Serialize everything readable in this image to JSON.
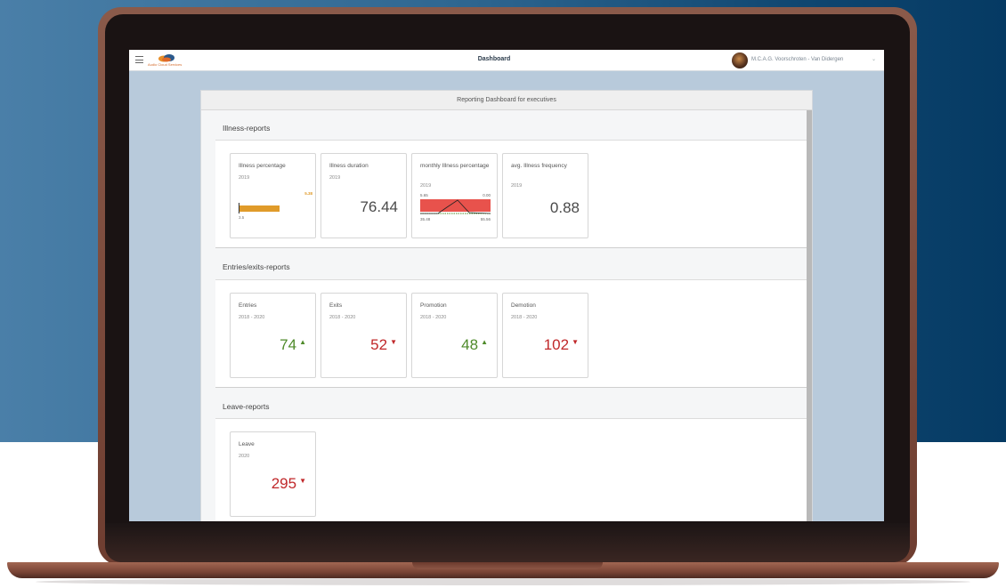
{
  "topbar": {
    "logo_text": "Audio Cloud Services",
    "title": "Dashboard",
    "user_name": "M.C.A.G. Voorschroten - Van Didergen",
    "user_chevron": "⌄"
  },
  "panel": {
    "header": "Reporting Dashboard for executives"
  },
  "sections": {
    "illness": {
      "title": "Illness-reports",
      "tiles": {
        "percentage": {
          "title": "Illness percentage",
          "year": "2019",
          "value_label": "5.38",
          "min_label": "3.5",
          "fill_fraction": 0.6
        },
        "duration": {
          "title": "Illness duration",
          "year": "2019",
          "value": "76.44"
        },
        "monthly": {
          "title": "monthly Illness percentage",
          "year": "2019",
          "y_top": "5.65",
          "y_right": "0.00",
          "x_left": "35.48",
          "x_right": "55.56"
        },
        "frequency": {
          "title": "avg. Illness frequency",
          "year": "2019",
          "value": "0.88"
        }
      }
    },
    "entries": {
      "title": "Entries/exits-reports",
      "tiles": {
        "entries": {
          "title": "Entries",
          "period": "2018 - 2020",
          "value": "74",
          "arrow": "▲"
        },
        "exits": {
          "title": "Exits",
          "period": "2018 - 2020",
          "value": "52",
          "arrow": "▼"
        },
        "promotion": {
          "title": "Promotion",
          "period": "2018 - 2020",
          "value": "48",
          "arrow": "▲"
        },
        "demotion": {
          "title": "Demotion",
          "period": "2018 - 2020",
          "value": "102",
          "arrow": "▼"
        }
      }
    },
    "leave": {
      "title": "Leave-reports",
      "tiles": {
        "leave": {
          "title": "Leave",
          "period": "2020",
          "value": "295",
          "arrow": "▼"
        }
      }
    }
  },
  "colors": {
    "good": "#4e8a2a",
    "bad": "#c0282a",
    "bar": "#e09b2a",
    "chart_band": "#e8524c"
  }
}
